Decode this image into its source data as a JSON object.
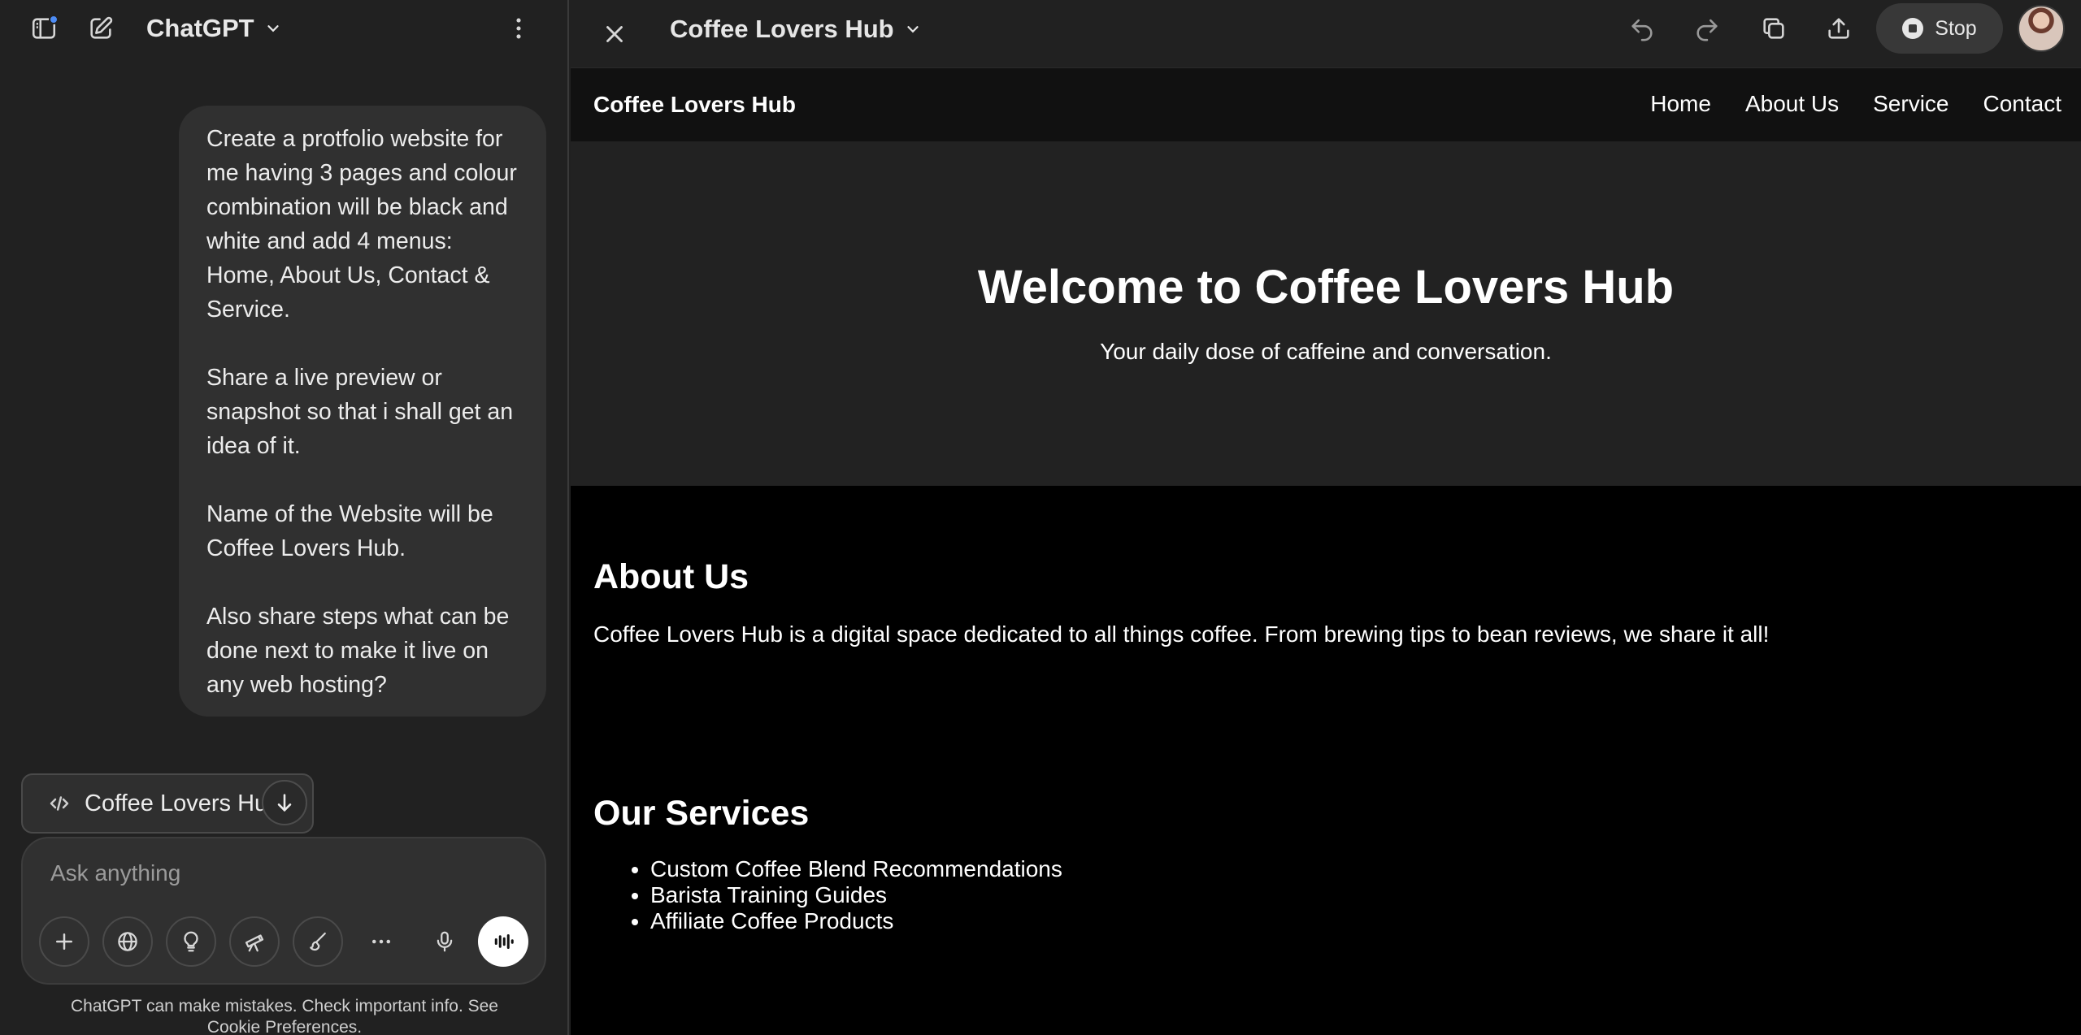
{
  "chat": {
    "app_title": "ChatGPT",
    "user_message": {
      "paragraphs": [
        "Create a protfolio website for me having 3 pages and colour combination will be black and white and add 4 menus: Home, About Us, Contact & Service.",
        "Share a live preview or snapshot so that i shall get an idea of it.",
        "Name of the Website will be Coffee Lovers Hub.",
        "Also share steps what can be done next to make it live on any web hosting?"
      ]
    },
    "canvas_chip_label": "Coffee Lovers Hub",
    "composer_placeholder": "Ask anything",
    "disclaimer": "ChatGPT can make mistakes. Check important info. See Cookie Preferences."
  },
  "canvas": {
    "doc_title": "Coffee Lovers Hub",
    "stop_label": "Stop"
  },
  "site": {
    "brand": "Coffee Lovers Hub",
    "nav": [
      "Home",
      "About Us",
      "Service",
      "Contact"
    ],
    "hero_title": "Welcome to Coffee Lovers Hub",
    "hero_subtitle": "Your daily dose of caffeine and conversation.",
    "about_heading": "About Us",
    "about_text": "Coffee Lovers Hub is a digital space dedicated to all things coffee. From brewing tips to bean reviews, we share it all!",
    "services_heading": "Our Services",
    "services": [
      "Custom Coffee Blend Recommendations",
      "Barista Training Guides",
      "Affiliate Coffee Products"
    ]
  },
  "colors": {
    "sidebar_bg": "#212121",
    "bubble_bg": "#303030",
    "accent_dot": "#4d8cf5",
    "site_bg": "#000000",
    "hero_bg": "#222222",
    "site_nav_bg": "#111111"
  },
  "icons": {
    "sidebar_toggle": "sidebar-toggle-icon",
    "new_chat": "new-chat-icon",
    "more": "more-vertical-icon",
    "close": "close-icon",
    "undo": "undo-icon",
    "redo": "redo-icon",
    "copy": "copy-icon",
    "share": "share-icon",
    "stop": "stop-icon",
    "code": "code-icon",
    "arrow_down": "arrow-down-icon",
    "composer_tools": [
      "plus-icon",
      "globe-icon",
      "lightbulb-icon",
      "telescope-icon",
      "brush-icon",
      "ellipsis-icon",
      "mic-icon",
      "voice-mode-icon"
    ]
  }
}
